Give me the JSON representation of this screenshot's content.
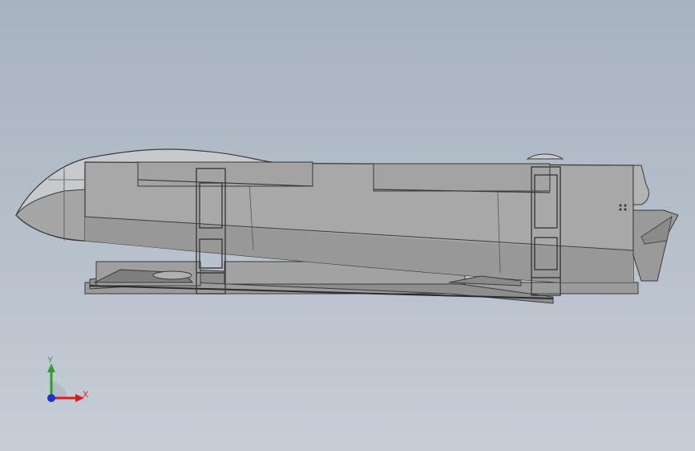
{
  "viewport": {
    "background_top": "#a8b3c0",
    "background_bottom": "#c6ced6"
  },
  "model": {
    "body_color": "#a8a8a8",
    "edge_color": "#3a3a3a",
    "canopy_color": "#c7c9cc"
  },
  "triad": {
    "x_label": "X",
    "y_label": "Y",
    "x_color": "#d21f1f",
    "y_color": "#2aa12a",
    "z_color": "#1f2fd2"
  }
}
